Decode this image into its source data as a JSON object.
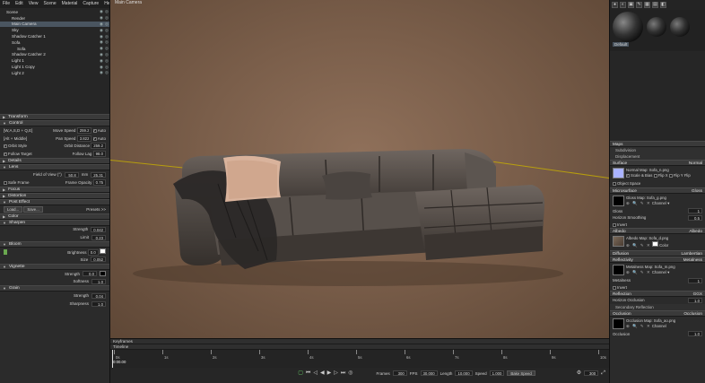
{
  "menu": [
    "File",
    "Edit",
    "View",
    "Scene",
    "Material",
    "Capture",
    "Help"
  ],
  "tree": [
    {
      "label": "Scene",
      "indent": 0
    },
    {
      "label": "Render",
      "indent": 1
    },
    {
      "label": "Main Camera",
      "indent": 1,
      "selected": true
    },
    {
      "label": "Sky",
      "indent": 1
    },
    {
      "label": "Shadow Catcher 1",
      "indent": 1
    },
    {
      "label": "Sofa",
      "indent": 1
    },
    {
      "label": "Sofa",
      "indent": 2
    },
    {
      "label": "Shadow Catcher 2",
      "indent": 1
    },
    {
      "label": "Light 1",
      "indent": 1
    },
    {
      "label": "Light 1 Copy",
      "indent": 1
    },
    {
      "label": "Light 2",
      "indent": 1
    }
  ],
  "left": {
    "transform": "Transform",
    "control": "Control",
    "wasd": "[W,A,S,D + Q,E]",
    "move_speed_label": "Move Speed",
    "move_speed": "259.2",
    "auto": "Auto",
    "alt_middle": "[Alt + Middle]",
    "pan_speed_label": "Pan Speed",
    "pan_speed": "3.822",
    "orbit_style": "Orbit Style",
    "orbit_distance_label": "Orbit Distance",
    "orbit_distance": "259.2",
    "follow_target": "Follow Target",
    "follow_lag_label": "Follow Lag",
    "follow_lag": "98.0",
    "details": "Details",
    "lens": "Lens",
    "fov_label": "Field of View (°)",
    "fov": "50.8",
    "mm": "mm",
    "mm_value": "25.31",
    "safe_frame": "Safe Frame",
    "frame_opacity_label": "Frame Opacity",
    "frame_opacity": "0.75",
    "focus": "Focus",
    "distortion": "Distortion",
    "post_effect": "Post Effect",
    "load": "Load...",
    "save": "Save...",
    "presets": "Presets >>",
    "color": "Color",
    "sharpen": "Sharpen",
    "strength_label": "Strength",
    "sharpen_strength": "0.042",
    "limit_label": "Limit",
    "sharpen_limit": "0.23",
    "bloom": "Bloom",
    "brightness_label": "Brightness",
    "bloom_brightness": "0.0",
    "size_label": "Size",
    "bloom_size": "0.052",
    "vignette": "Vignette",
    "vignette_strength": "0.0",
    "softness_label": "Softness",
    "vignette_softness": "1.0",
    "grain": "Grain",
    "grain_strength": "0.04",
    "sharpness_label": "Sharpness",
    "grain_sharpness": "1.0"
  },
  "viewport": {
    "tab": "Main Camera"
  },
  "timeline": {
    "keyframes": "Keyframes",
    "timeline": "Timeline",
    "current": "0:00.00",
    "ticks": [
      "0s",
      "1s",
      "2s",
      "3s",
      "4s",
      "5s",
      "6s",
      "7s",
      "8s",
      "9s",
      "10s"
    ],
    "frames_label": "Frames",
    "frames": "300",
    "fps_label": "FPS",
    "fps": "30.000",
    "length_label": "Length",
    "length": "10.000",
    "speed_label": "Speed",
    "speed": "1.000",
    "bake_speed": "Bake Speed",
    "end": "300"
  },
  "right": {
    "tools": [
      "●",
      "◐",
      "▣",
      "✎",
      "▦",
      "▤",
      "◧"
    ],
    "material_name": "Default",
    "maps": "Maps",
    "subdivision": "Subdivision",
    "displacement": "Displacement",
    "surface": "Surface",
    "normal": "Normal",
    "normal_map": "Normal Map: Sofa_n.png",
    "scale_bias": "Scale & Bias",
    "flip_x": "Flip X",
    "flip_y": "Flip Y",
    "flip_z": "Flip",
    "object_space": "Object Space",
    "microsurface": "Microsurface",
    "gloss": "Gloss",
    "gloss_map": "Gloss Map: Sofa_g.png",
    "channel": "Channel",
    "gloss_label": "Gloss",
    "gloss_value": "1",
    "horizon_smoothing": "Horizon Smoothing",
    "horizon_smoothing_value": "0.5",
    "invert": "Invert",
    "albedo": "Albedo",
    "albedo_map": "Albedo Map: Sofa_d.png",
    "color": "Color",
    "diffusion": "Diffusion",
    "lambertian": "Lambertian",
    "reflectivity": "Reflectivity",
    "metalness_header": "Metalness",
    "metalness_map": "Metalness Map: Sofa_m.png",
    "metalness_label": "Metalness",
    "metalness_value": "1",
    "invert2": "Invert",
    "reflection": "Reflection",
    "reflection_value": "GGX",
    "horizon_occlusion": "Horizon Occlusion",
    "horizon_occlusion_value": "1.0",
    "secondary_reflection": "Secondary Reflection",
    "occlusion": "Occlusion",
    "occlusion_header": "Occlusion",
    "occlusion_map": "Occlusion Map: Sofa_ao.png",
    "occlusion_label": "Occlusion",
    "occlusion_value": "1.0"
  }
}
